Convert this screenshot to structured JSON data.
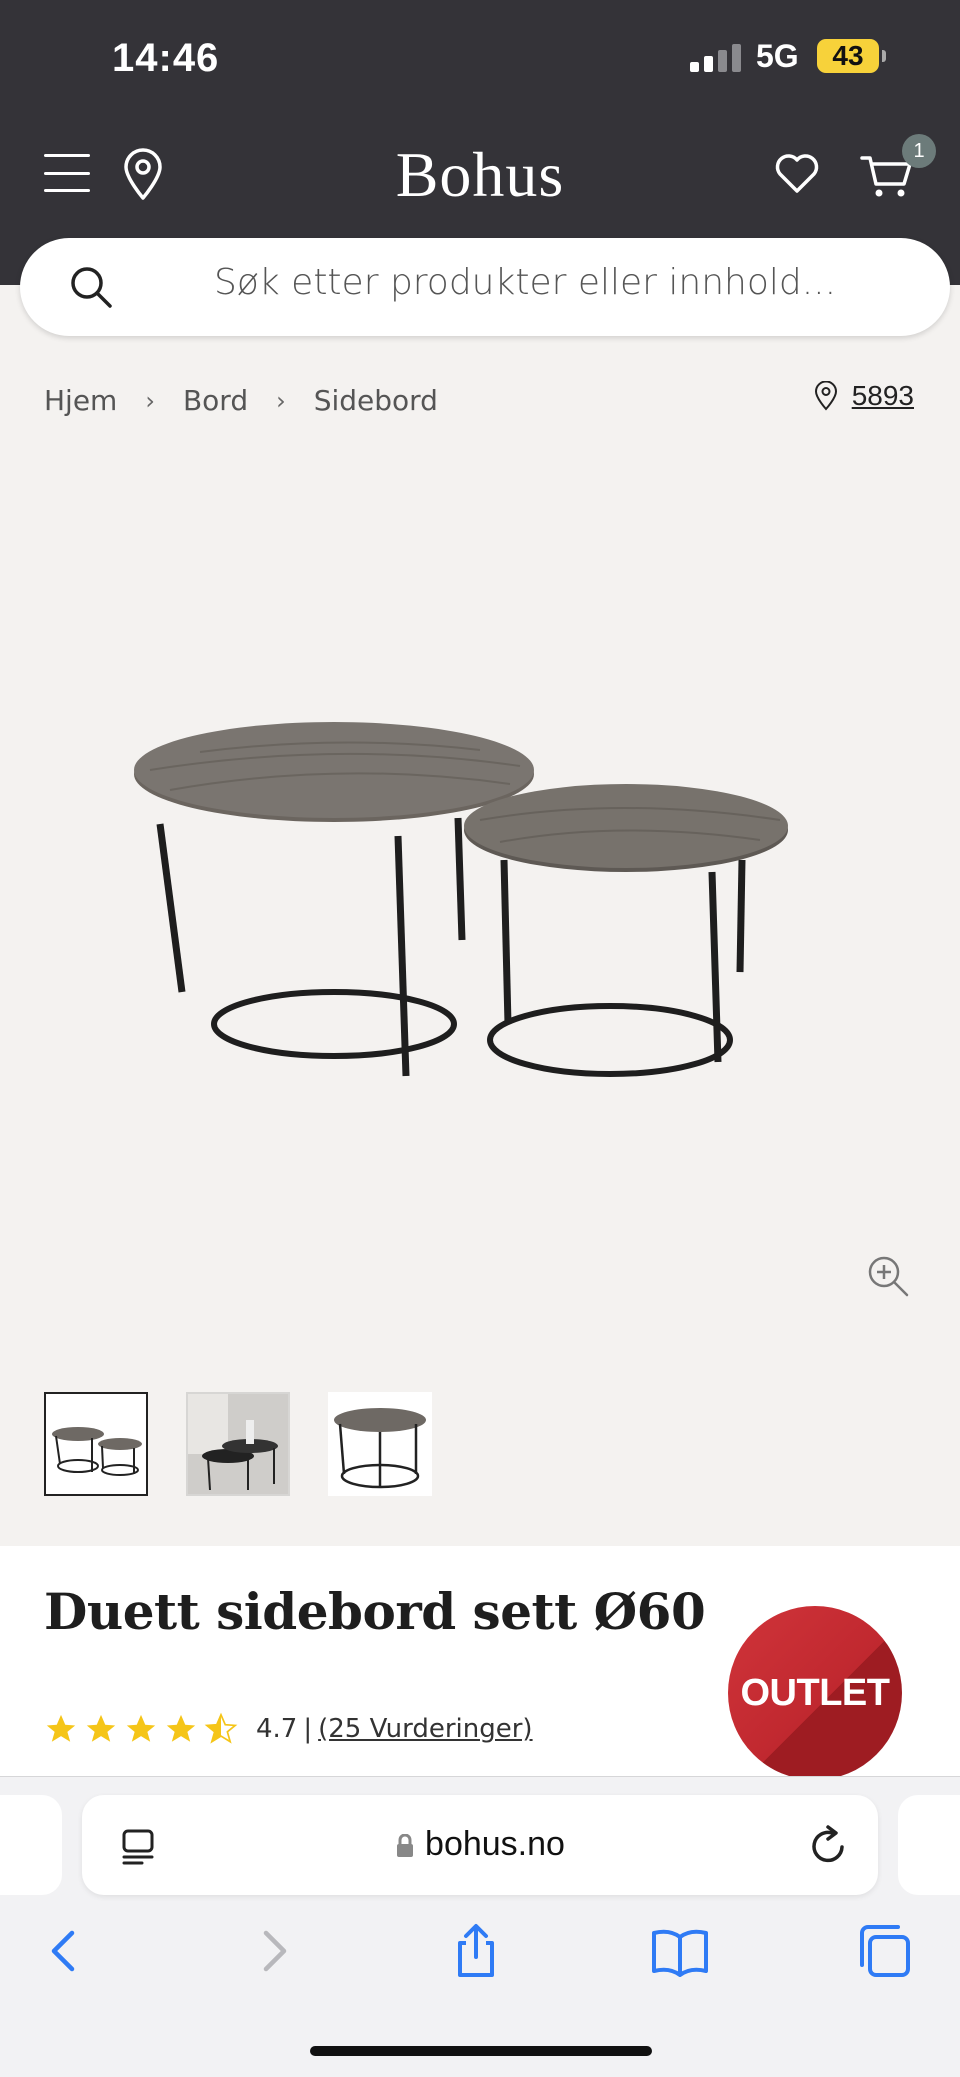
{
  "status_bar": {
    "time": "14:46",
    "network": "5G",
    "battery": "43"
  },
  "header": {
    "brand": "Bohus",
    "cart_count": "1",
    "icons": [
      "menu-icon",
      "location-pin-icon",
      "heart-icon",
      "cart-icon"
    ]
  },
  "search": {
    "placeholder": "Søk etter produkter eller innhold..."
  },
  "breadcrumb": {
    "items": [
      "Hjem",
      "Bord",
      "Sidebord"
    ],
    "store_number": "5893"
  },
  "product": {
    "title": "Duett sidebord sett Ø60",
    "rating_value": "4.7",
    "rating_separator": "|",
    "reviews_label": "(25 Vurderinger)",
    "rating_stars": 4.5,
    "badge": "OUTLET",
    "badge_color": "#c4282f",
    "star_color": "#f5c518"
  },
  "safari": {
    "url": "bohus.no"
  }
}
